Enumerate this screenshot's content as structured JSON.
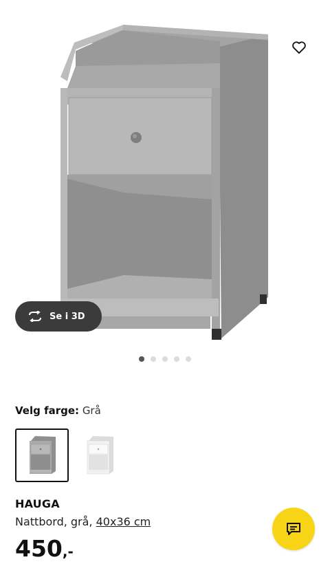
{
  "gallery": {
    "view_3d_label": "Se i 3D",
    "dots_total": 5,
    "dots_active": 1
  },
  "color_picker": {
    "label": "Velg farge:",
    "selected_value": "Grå",
    "options": [
      {
        "name": "grey-variant",
        "selected": true
      },
      {
        "name": "white-variant",
        "selected": false
      }
    ]
  },
  "product": {
    "name": "HAUGA",
    "description": "Nattbord, grå, ",
    "size_link": "40x36 cm",
    "price_int": "450",
    "price_suffix": ",-"
  },
  "icons": {
    "favorite": "heart-outline-icon",
    "rotate": "rotate-3d-icon",
    "chat": "chat-bubble-icon"
  },
  "colors": {
    "chat_bg": "#f7d516",
    "pill_bg": "#3b3b3b",
    "product_grey": "#a9a9a9"
  }
}
